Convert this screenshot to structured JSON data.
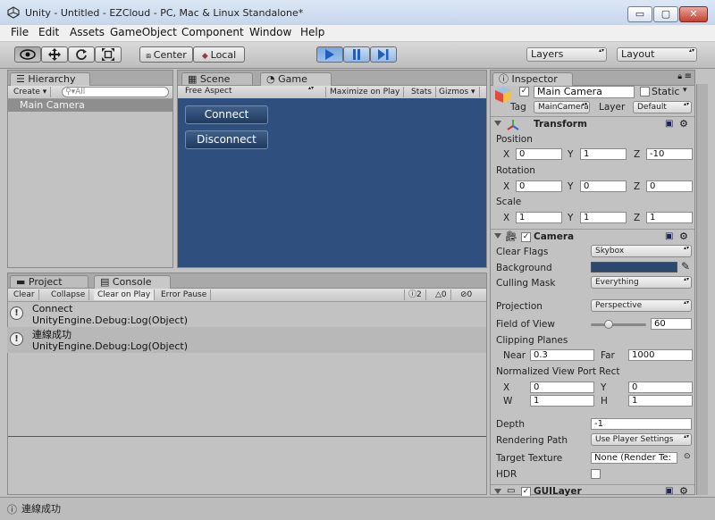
{
  "window": {
    "title": "Unity - Untitled - EZCloud - PC, Mac & Linux Standalone*",
    "controls": {
      "minimize": "▭",
      "maximize": "▢",
      "close": "✕"
    }
  },
  "menu": [
    "File",
    "Edit",
    "Assets",
    "GameObject",
    "Component",
    "Window",
    "Help"
  ],
  "toolbar": {
    "pivot": "Center",
    "space": "Local",
    "layers": "Layers",
    "layout": "Layout"
  },
  "hierarchy": {
    "tab": "Hierarchy",
    "create": "Create",
    "search_placeholder": "All",
    "items": [
      "Main Camera"
    ]
  },
  "scene_tabs": {
    "scene": "Scene",
    "game": "Game"
  },
  "game": {
    "aspect": "Free Aspect",
    "buttons": [
      "Maximize on Play",
      "Stats",
      "Gizmos"
    ],
    "background": "#2f4f7f",
    "ui_buttons": [
      "Connect",
      "Disconnect"
    ]
  },
  "bottom_tabs": {
    "project": "Project",
    "console": "Console"
  },
  "console": {
    "toolbar": [
      "Clear",
      "Collapse",
      "Clear on Play",
      "Error Pause"
    ],
    "counts": {
      "info": "2",
      "warn": "0",
      "error": "0"
    },
    "entries": [
      {
        "message": "Connect",
        "trace": "UnityEngine.Debug:Log(Object)"
      },
      {
        "message": "連線成功",
        "trace": "UnityEngine.Debug:Log(Object)"
      }
    ]
  },
  "inspector": {
    "tab": "Inspector",
    "object_name": "Main Camera",
    "static_label": "Static",
    "tag_label": "Tag",
    "tag_value": "MainCamera",
    "layer_label": "Layer",
    "layer_value": "Default",
    "transform": {
      "title": "Transform",
      "position_label": "Position",
      "rotation_label": "Rotation",
      "scale_label": "Scale",
      "position": [
        "0",
        "1",
        "-10"
      ],
      "rotation": [
        "0",
        "0",
        "0"
      ],
      "scale": [
        "1",
        "1",
        "1"
      ]
    },
    "camera": {
      "title": "Camera",
      "clear_flags_label": "Clear Flags",
      "clear_flags": "Skybox",
      "background_label": "Background",
      "background_color": "#2a4870",
      "culling_label": "Culling Mask",
      "culling": "Everything",
      "projection_label": "Projection",
      "projection": "Perspective",
      "fov_label": "Field of View",
      "fov": "60",
      "fov_slider_fraction": 0.33,
      "clipping_label": "Clipping Planes",
      "near_label": "Near",
      "near": "0.3",
      "far_label": "Far",
      "far": "1000",
      "viewport_label": "Normalized View Port Rect",
      "viewport": {
        "x": "0",
        "y": "0",
        "w": "1",
        "h": "1"
      },
      "depth_label": "Depth",
      "depth": "-1",
      "rendering_path_label": "Rendering Path",
      "rendering_path": "Use Player Settings",
      "target_texture_label": "Target Texture",
      "target_texture": "None (Render Te:",
      "hdr_label": "HDR"
    },
    "next_component": "GUILayer"
  },
  "status": {
    "message": "連線成功"
  }
}
